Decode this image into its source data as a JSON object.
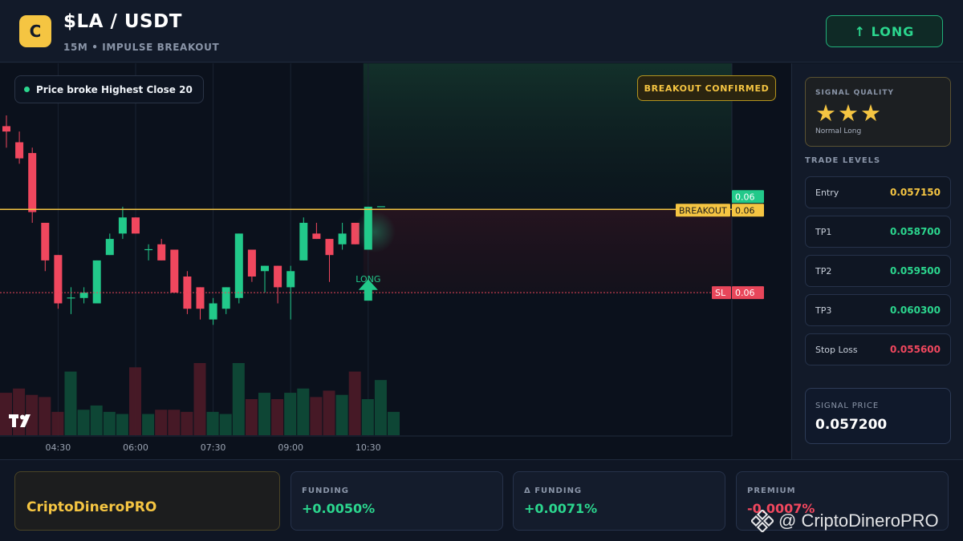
{
  "header": {
    "logo_letter": "C",
    "pair": "$LA / USDT",
    "subtitle": "15M • IMPULSE BREAKOUT",
    "long_button": "↑ LONG"
  },
  "chart": {
    "info_pill": "Price broke Highest Close 20",
    "confirm_badge": "BREAKOUT CONFIRMED",
    "long_marker": "LONG",
    "tv_logo": "tradingview-logo",
    "time_labels": [
      {
        "label": "04:30",
        "index": 4
      },
      {
        "label": "06:00",
        "index": 10
      },
      {
        "label": "07:30",
        "index": 16
      },
      {
        "label": "09:00",
        "index": 22
      },
      {
        "label": "10:30",
        "index": 28
      }
    ],
    "price_tags": {
      "current": "0.06",
      "breakout_label": "BREAKOUT",
      "breakout_value": "0.06",
      "sl_label": "SL",
      "sl_value": "0.06"
    },
    "levels": {
      "breakout": 0.05715,
      "stop_loss": 0.0556
    },
    "colors": {
      "up": "#22c98a",
      "down": "#f0475e",
      "breakout": "#f5c542",
      "sl": "#e8465a"
    },
    "candles": [
      {
        "o": 0.0587,
        "h": 0.0589,
        "l": 0.0583,
        "c": 0.0586
      },
      {
        "o": 0.0584,
        "h": 0.0586,
        "l": 0.058,
        "c": 0.0581
      },
      {
        "o": 0.0582,
        "h": 0.0583,
        "l": 0.0569,
        "c": 0.0571
      },
      {
        "o": 0.0569,
        "h": 0.0569,
        "l": 0.056,
        "c": 0.0562
      },
      {
        "o": 0.0563,
        "h": 0.0563,
        "l": 0.0553,
        "c": 0.0554
      },
      {
        "o": 0.0555,
        "h": 0.0557,
        "l": 0.0552,
        "c": 0.0555
      },
      {
        "o": 0.0555,
        "h": 0.0557,
        "l": 0.0554,
        "c": 0.0556
      },
      {
        "o": 0.0554,
        "h": 0.0562,
        "l": 0.0554,
        "c": 0.0562
      },
      {
        "o": 0.0563,
        "h": 0.0567,
        "l": 0.0563,
        "c": 0.0566
      },
      {
        "o": 0.0567,
        "h": 0.0572,
        "l": 0.0566,
        "c": 0.057
      },
      {
        "o": 0.057,
        "h": 0.057,
        "l": 0.0567,
        "c": 0.0567
      },
      {
        "o": 0.0564,
        "h": 0.0565,
        "l": 0.0562,
        "c": 0.0564
      },
      {
        "o": 0.0565,
        "h": 0.0566,
        "l": 0.0562,
        "c": 0.0562
      },
      {
        "o": 0.0564,
        "h": 0.0564,
        "l": 0.0556,
        "c": 0.0556
      },
      {
        "o": 0.0559,
        "h": 0.056,
        "l": 0.0552,
        "c": 0.0553
      },
      {
        "o": 0.0557,
        "h": 0.0557,
        "l": 0.0551,
        "c": 0.0553
      },
      {
        "o": 0.0551,
        "h": 0.0555,
        "l": 0.055,
        "c": 0.0554
      },
      {
        "o": 0.0553,
        "h": 0.0557,
        "l": 0.0552,
        "c": 0.0557
      },
      {
        "o": 0.0555,
        "h": 0.0567,
        "l": 0.0554,
        "c": 0.0567
      },
      {
        "o": 0.0564,
        "h": 0.0564,
        "l": 0.0558,
        "c": 0.0559
      },
      {
        "o": 0.056,
        "h": 0.0561,
        "l": 0.0556,
        "c": 0.0561
      },
      {
        "o": 0.0561,
        "h": 0.0561,
        "l": 0.0554,
        "c": 0.0557
      },
      {
        "o": 0.0557,
        "h": 0.0561,
        "l": 0.0551,
        "c": 0.056
      },
      {
        "o": 0.0562,
        "h": 0.057,
        "l": 0.0562,
        "c": 0.0569
      },
      {
        "o": 0.0567,
        "h": 0.0569,
        "l": 0.0566,
        "c": 0.0566
      },
      {
        "o": 0.0566,
        "h": 0.0566,
        "l": 0.0558,
        "c": 0.0563
      },
      {
        "o": 0.0565,
        "h": 0.0569,
        "l": 0.0564,
        "c": 0.0567
      },
      {
        "o": 0.0569,
        "h": 0.0569,
        "l": 0.0565,
        "c": 0.0565
      },
      {
        "o": 0.0564,
        "h": 0.0572,
        "l": 0.0564,
        "c": 0.0572
      },
      {
        "o": 0.0572,
        "h": 0.0572,
        "l": 0.0572,
        "c": 0.0572
      }
    ],
    "volumes": [
      20,
      22,
      19,
      18,
      11,
      30,
      12,
      14,
      11,
      10,
      32,
      10,
      12,
      12,
      11,
      34,
      11,
      10,
      34,
      17,
      20,
      17,
      20,
      22,
      18,
      21,
      19,
      30,
      17,
      26,
      11
    ]
  },
  "sidebar": {
    "quality_title": "SIGNAL QUALITY",
    "stars": "★★★",
    "quality_label": "Normal Long",
    "levels_title": "TRADE LEVELS",
    "levels": [
      {
        "name": "Entry",
        "value": "0.057150",
        "color": "#f5c542"
      },
      {
        "name": "TP1",
        "value": "0.058700",
        "color": "#2bd68e"
      },
      {
        "name": "TP2",
        "value": "0.059500",
        "color": "#2bd68e"
      },
      {
        "name": "TP3",
        "value": "0.060300",
        "color": "#2bd68e"
      },
      {
        "name": "Stop Loss",
        "value": "0.055600",
        "color": "#f0475e"
      }
    ],
    "signal_price_title": "SIGNAL PRICE",
    "signal_price": "0.057200"
  },
  "footer": {
    "brand": "CriptoDineroPRO",
    "funding_title": "FUNDING",
    "funding_value": "+0.0050%",
    "dfunding_title": "Δ FUNDING",
    "dfunding_value": "+0.0071%",
    "premium_title": "PREMIUM",
    "premium_value": "-0.0007%",
    "watermark": "@ CriptoDineroPRO"
  }
}
